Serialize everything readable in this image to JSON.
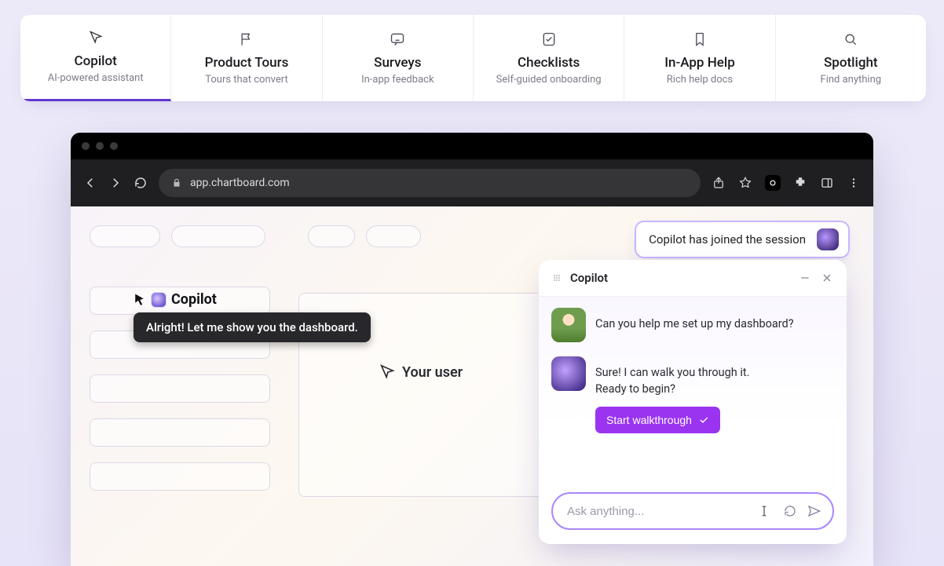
{
  "tabs": [
    {
      "title": "Copilot",
      "sub": "AI-powered assistant"
    },
    {
      "title": "Product Tours",
      "sub": "Tours that convert"
    },
    {
      "title": "Surveys",
      "sub": "In-app feedback"
    },
    {
      "title": "Checklists",
      "sub": "Self-guided onboarding"
    },
    {
      "title": "In-App Help",
      "sub": "Rich help docs"
    },
    {
      "title": "Spotlight",
      "sub": "Find anything"
    }
  ],
  "browser": {
    "url": "app.chartboard.com"
  },
  "toast": {
    "text": "Copilot has joined the session"
  },
  "cursor": {
    "label": "Copilot",
    "bubble": "Alright! Let me show you the dashboard."
  },
  "userCursor": {
    "label": "Your user"
  },
  "copilot": {
    "title": "Copilot",
    "messages": {
      "user": "Can you help me set up my dashboard?",
      "bot_line1": "Sure! I can walk you through it.",
      "bot_line2": "Ready to begin?"
    },
    "walk_button": "Start walkthrough",
    "input_placeholder": "Ask anything..."
  }
}
